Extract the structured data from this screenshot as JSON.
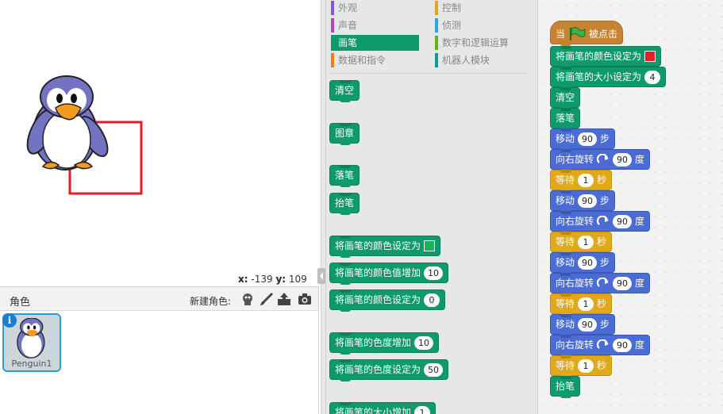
{
  "stage": {
    "coords": {
      "x_label": "x:",
      "x_value": "-139",
      "y_label": "y:",
      "y_value": "109"
    }
  },
  "sprites": {
    "title": "角色",
    "new_sprite_label": "新建角色:",
    "items": [
      {
        "name": "Penguin1"
      }
    ]
  },
  "categories": [
    {
      "label": "外观",
      "color": "#8a55d7"
    },
    {
      "label": "控制",
      "color": "#e1a91a"
    },
    {
      "label": "声音",
      "color": "#bb42c3"
    },
    {
      "label": "侦测",
      "color": "#2ca5e2"
    },
    {
      "label": "画笔",
      "color": "#0e9a6c",
      "selected": true
    },
    {
      "label": "数字和逻辑运算",
      "color": "#5cb712"
    },
    {
      "label": "数据和指令",
      "color": "#ee7d16"
    },
    {
      "label": "机器人模块",
      "color": "#0e9a9a"
    }
  ],
  "palette": {
    "clear": "清空",
    "stamp": "图章",
    "pen_down": "落笔",
    "pen_up": "抬笔",
    "set_color_to": "将画笔的颜色设定为",
    "change_color_by": "将画笔的颜色值增加",
    "change_color_by_value": "10",
    "set_color_value_to": "将画笔的颜色设定为",
    "set_color_value_to_value": "0",
    "change_shade_by": "将画笔的色度增加",
    "change_shade_by_value": "10",
    "set_shade_to": "将画笔的色度设定为",
    "set_shade_to_value": "50",
    "change_size_by": "将画笔的大小增加",
    "change_size_by_value": "1"
  },
  "script": {
    "hat_when": "当",
    "hat_clicked": "被点击",
    "set_color": "将画笔的颜色设定为",
    "set_size": "将画笔的大小设定为",
    "set_size_value": "4",
    "clear": "清空",
    "pen_down": "落笔",
    "move": "移动",
    "steps": "步",
    "move_value": "90",
    "turn_right": "向右旋转",
    "turn_value": "90",
    "degrees": "度",
    "wait": "等待",
    "wait_value": "1",
    "seconds": "秒",
    "pen_up": "抬笔"
  },
  "colors": {
    "pen": "#0e9a6c",
    "motion": "#4a6cd4",
    "control": "#e1a91a",
    "events": "#c88330",
    "red_swatch": "#e31e24",
    "green_swatch": "#19b35a"
  },
  "icons": [
    "green-flag-icon",
    "turn-right-icon",
    "penguin-sprite",
    "paintbrush-icon",
    "upload-icon",
    "camera-icon",
    "info-icon"
  ]
}
